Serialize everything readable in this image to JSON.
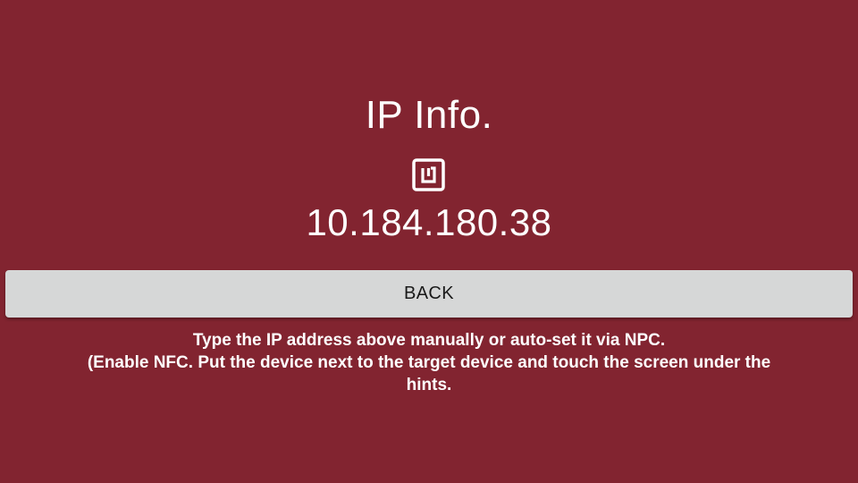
{
  "colors": {
    "background": "#822430",
    "text": "#ffffff",
    "button_bg": "#d6d7d7",
    "button_text": "#1a1a1a"
  },
  "header": {
    "title": "IP Info.",
    "icon": "nfc-icon"
  },
  "ip": {
    "address": "10.184.180.38"
  },
  "actions": {
    "back_label": "BACK"
  },
  "hints": {
    "line1": "Type the IP address above manually or auto-set it via NPC.",
    "line2": "(Enable NFC. Put the device next to the target device and touch the screen under the hints."
  }
}
